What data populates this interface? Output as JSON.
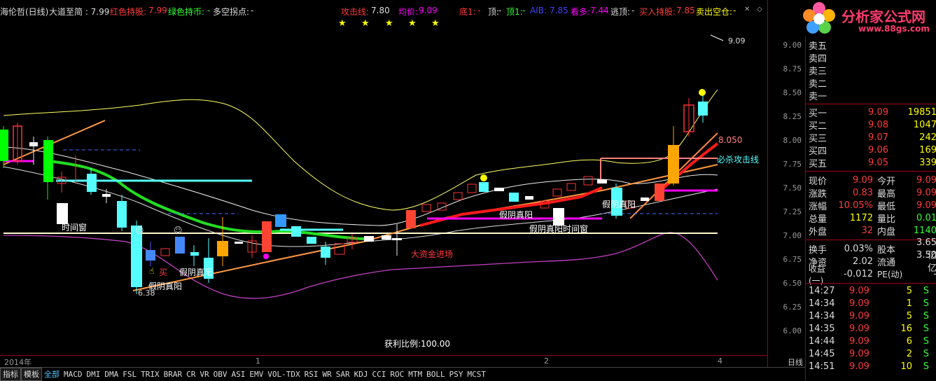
{
  "header": {
    "stock": "海伦哲(日线)",
    "line1_label": "大道至简 : 7.99",
    "red_hold_label": "红色持股:",
    "red_hold_val": "7.99",
    "green_hold_label": "绿色持币:",
    "green_hold_val": "-",
    "longshort_label": "多空拐点:",
    "longshort_val": "-",
    "attack_label": "攻击线:",
    "attack_val": "7.80",
    "avg_label": "均价:",
    "avg_val": "9.09",
    "bottom_label": "底1:",
    "bottom_val": "-",
    "top_label": "顶:",
    "top_val": "-",
    "top1_label": "顶1:",
    "top1_val": "-",
    "aib_label": "AIB:",
    "aib_val": "7.85",
    "look_up_label": "看多:",
    "look_up_val": "7.44",
    "escape_top_label": "逃顶:",
    "escape_top_val": "-",
    "buy_hold_label": "买入持股:",
    "buy_hold_val": "7.85",
    "sell_short_label": "卖出空仓:",
    "sell_short_val": "-"
  },
  "colors": {
    "up": "#ff3b3b",
    "down": "#54ffff",
    "yellow": "#ffff00",
    "magenta": "#ff00ff",
    "green": "#00ff00",
    "orange": "#ff8c00"
  },
  "yaxis_ticks": [
    "9.00",
    "8.75",
    "8.50",
    "8.25",
    "8.00",
    "7.75",
    "7.50",
    "7.25",
    "7.00",
    "6.75",
    "6.50",
    "6.25",
    "6.00"
  ],
  "xaxis": {
    "year": "2014年",
    "m1": "1",
    "m2": "2",
    "m4": "4",
    "period": "日线"
  },
  "annotations": {
    "high_mark": "9.09",
    "low_mark": "6.38",
    "line_value": "8.050",
    "kill_line": "必杀攻击线",
    "time_window_1": "时间窗",
    "time_window_2": "假阴真阳时间窗",
    "fake_yin_1": "假阴真阳",
    "fake_yin_2": "假阴真阳",
    "fake_yin_3": "假阴真阳",
    "fake_yin_4": "假阴真阳",
    "buy_label": "买",
    "big_money": "大资金进场",
    "profit_ratio": "获利比例:100.00"
  },
  "tabs": [
    "指标",
    "模板",
    "全部",
    "MACD",
    "DMI",
    "DMA",
    "FSL",
    "TRIX",
    "BRAR",
    "CR",
    "VR",
    "OBV",
    "ASI",
    "EMV",
    "VOL-TDX",
    "RSI",
    "WR",
    "SAR",
    "KDJ",
    "CCI",
    "ROC",
    "MTM",
    "BOLL",
    "PSY",
    "MCST"
  ],
  "logo": {
    "title": "分析家公式网",
    "url": "www.88gs.com"
  },
  "order_book": {
    "sell": [
      {
        "label": "卖五",
        "price": "",
        "vol": ""
      },
      {
        "label": "卖四",
        "price": "",
        "vol": ""
      },
      {
        "label": "卖三",
        "price": "",
        "vol": ""
      },
      {
        "label": "卖二",
        "price": "",
        "vol": ""
      },
      {
        "label": "卖一",
        "price": "",
        "vol": ""
      }
    ],
    "buy": [
      {
        "label": "买一",
        "price": "9.09",
        "vol": "19851"
      },
      {
        "label": "买二",
        "price": "9.08",
        "vol": "1047"
      },
      {
        "label": "买三",
        "price": "9.07",
        "vol": "242"
      },
      {
        "label": "买四",
        "price": "9.06",
        "vol": "169"
      },
      {
        "label": "买五",
        "price": "9.05",
        "vol": "339"
      }
    ]
  },
  "quote": [
    {
      "l1": "现价",
      "v1": "9.09",
      "l2": "今开",
      "v2": "9.09"
    },
    {
      "l1": "涨跌",
      "v1": "0.83",
      "l2": "最高",
      "v2": "9.09"
    },
    {
      "l1": "涨幅",
      "v1": "10.05%",
      "l2": "最低",
      "v2": "9.09"
    },
    {
      "l1": "总量",
      "v1": "1172",
      "l2": "量比",
      "v2": "0.01"
    },
    {
      "l1": "外盘",
      "v1": "32",
      "l2": "内盘",
      "v2": "1140"
    }
  ],
  "fundamentals": [
    {
      "l1": "换手",
      "v1": "0.03%",
      "l2": "股本",
      "v2": "3.65亿"
    },
    {
      "l1": "净资",
      "v1": "2.02",
      "l2": "流通",
      "v2": "3.50亿"
    },
    {
      "l1": "收益(一)",
      "v1": "-0.012",
      "l2": "PE(动)",
      "v2": "-"
    }
  ],
  "ticks": [
    {
      "time": "14:27",
      "price": "9.09",
      "vol": "5",
      "side": "S"
    },
    {
      "time": "14:34",
      "price": "9.09",
      "vol": "1",
      "side": "S"
    },
    {
      "time": "14:34",
      "price": "9.09",
      "vol": "5",
      "side": "S"
    },
    {
      "time": "14:35",
      "price": "9.09",
      "vol": "16",
      "side": "S"
    },
    {
      "time": "14:44",
      "price": "9.09",
      "vol": "6",
      "side": "S"
    },
    {
      "time": "14:45",
      "price": "9.09",
      "vol": "2",
      "side": "S"
    },
    {
      "time": "14:51",
      "price": "9.09",
      "vol": "10",
      "side": "S"
    }
  ]
}
